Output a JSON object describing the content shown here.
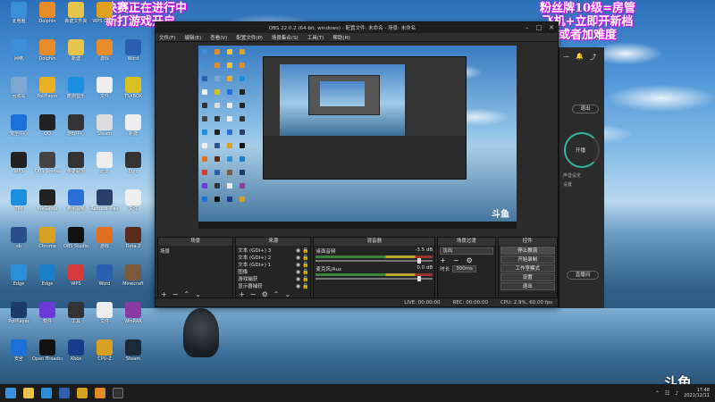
{
  "overlay": {
    "left_lines": [
      "决赛正在进行中",
      "新打游戏开启"
    ],
    "right_lines": [
      "粉丝牌10级=房管",
      "飞机+立即开新档",
      "或者加难度"
    ]
  },
  "desktop_icons": [
    {
      "label": "此电脑",
      "color": "#3a8fd8"
    },
    {
      "label": "Dolphin",
      "color": "#e58b2a"
    },
    {
      "label": "新建文件夹",
      "color": "#e8c44a"
    },
    {
      "label": "WPS Office",
      "color": "#e0a020"
    },
    {
      "label": "网络",
      "color": "#3a8fd8"
    },
    {
      "label": "Dolphin",
      "color": "#e58b2a"
    },
    {
      "label": "新建",
      "color": "#e8c44a"
    },
    {
      "label": "游戏",
      "color": "#e58b2a"
    },
    {
      "label": "Word",
      "color": "#2b5fb0"
    },
    {
      "label": "回收站",
      "color": "#7fa8d0"
    },
    {
      "label": "PotPlayer",
      "color": "#e8b020"
    },
    {
      "label": "酷狗音乐",
      "color": "#1a8fe0"
    },
    {
      "label": "文件",
      "color": "#eee"
    },
    {
      "label": "TSXBOX",
      "color": "#d8c020"
    },
    {
      "label": "安全中心",
      "color": "#1a6fd8"
    },
    {
      "label": "QQ",
      "color": "#222"
    },
    {
      "label": "游戏中心",
      "color": "#333"
    },
    {
      "label": "Steam",
      "color": "#ddd"
    },
    {
      "label": "新建",
      "color": "#eee"
    },
    {
      "label": "WPS",
      "color": "#222"
    },
    {
      "label": "OBS Studio",
      "color": "#444"
    },
    {
      "label": "英雄联盟",
      "color": "#333"
    },
    {
      "label": "迅雷",
      "color": "#eee"
    },
    {
      "label": "Epic",
      "color": "#333"
    },
    {
      "label": "TIM",
      "color": "#1a8fe0"
    },
    {
      "label": "WeGame",
      "color": "#222"
    },
    {
      "label": "腾讯视频",
      "color": "#2a6fd8"
    },
    {
      "label": "Remote Play",
      "color": "#2a3f6a"
    },
    {
      "label": "文件",
      "color": "#eee"
    },
    {
      "label": "sb",
      "color": "#2a4f8a"
    },
    {
      "label": "Chrome",
      "color": "#d8a020"
    },
    {
      "label": "OBS Studio",
      "color": "#111"
    },
    {
      "label": "游戏",
      "color": "#e07020"
    },
    {
      "label": "Dota 2",
      "color": "#5a2a1a"
    },
    {
      "label": "Edge",
      "color": "#2a8fd8"
    },
    {
      "label": "Edge",
      "color": "#1a7fc8"
    },
    {
      "label": "WPS",
      "color": "#d83a3a"
    },
    {
      "label": "Word",
      "color": "#2b5fb0"
    },
    {
      "label": "Minecraft",
      "color": "#7a5a3a"
    },
    {
      "label": "PotPlayer",
      "color": "#1a3a6a"
    },
    {
      "label": "软件",
      "color": "#6a3ad8"
    },
    {
      "label": "工具",
      "color": "#333"
    },
    {
      "label": "文件",
      "color": "#eee"
    },
    {
      "label": "WinRAR",
      "color": "#8a3aa0"
    },
    {
      "label": "安全",
      "color": "#1a6fd8"
    },
    {
      "label": "Open Broadcaster",
      "color": "#111"
    },
    {
      "label": "Xbox",
      "color": "#1a3a8a"
    },
    {
      "label": "CPU-Z",
      "color": "#d8a020"
    },
    {
      "label": "Steam",
      "color": "#1b2838"
    }
  ],
  "obs": {
    "title": "OBS 22.0.2 (64-bit, windows) - 配置文件: 未命名 - 场景: 未命名",
    "menus": [
      "文件(F)",
      "编辑(E)",
      "查看(V)",
      "配置文件(P)",
      "场景集合(S)",
      "工具(T)",
      "帮助(H)"
    ],
    "docks": {
      "scenes": {
        "title": "场景",
        "items": [
          "场景"
        ]
      },
      "sources": {
        "title": "来源",
        "items": [
          "文本 (GDI+) 3",
          "文本 (GDI+) 2",
          "文本 (GDI+) 1",
          "图像",
          "游戏捕获",
          "显示器捕获"
        ]
      },
      "mixer": {
        "title": "混音器",
        "channels": [
          {
            "name": "桌面音频",
            "db": "-3.5 dB"
          },
          {
            "name": "麦克风/Aux",
            "db": "0.0 dB"
          }
        ]
      },
      "transitions": {
        "title": "场景过渡",
        "type": "淡出",
        "duration_label": "时长",
        "duration": "300ms"
      },
      "controls": {
        "title": "控件",
        "buttons": [
          "停止推流",
          "开始录制",
          "工作室模式",
          "设置",
          "退出"
        ]
      }
    },
    "status": {
      "live": "LIVE: 00:00:00",
      "rec": "REC: 00:00:00",
      "cpu": "CPU: 2.9%, 60.00 fps"
    }
  },
  "live_panel": {
    "close_label": "退出",
    "ring_label": "开播",
    "bottom_label": "直播间",
    "side_a": "声音设定",
    "side_b": "设置"
  },
  "taskbar": {
    "clock_time": "17:48",
    "clock_date": "2021/12/11"
  },
  "brand": "斗鱼"
}
